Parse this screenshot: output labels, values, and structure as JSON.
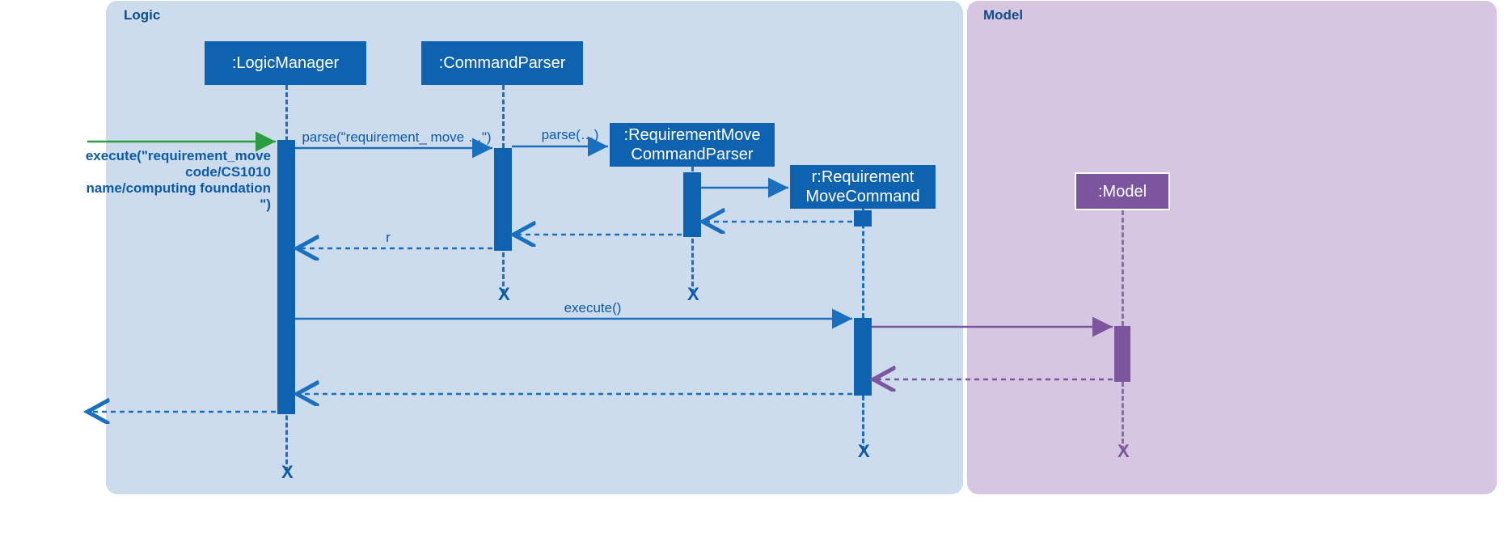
{
  "frames": {
    "logic": "Logic",
    "model": "Model"
  },
  "lifelines": {
    "logicmanager": ":LogicManager",
    "commandparser": ":CommandParser",
    "reqmoveparser_l1": ":RequirementMove",
    "reqmoveparser_l2": "CommandParser",
    "reqmovecmd_l1": "r:Requirement",
    "reqmovecmd_l2": "MoveCommand",
    "model": ":Model"
  },
  "messages": {
    "entry_l1": "execute(\"requirement_move",
    "entry_l2": "code/CS1010",
    "entry_l3": "name/computing foundation \")",
    "parse1": "parse(\"requirement_ move …\")",
    "parse2": "parse(…)",
    "return_r": "r",
    "execute": "execute()"
  }
}
